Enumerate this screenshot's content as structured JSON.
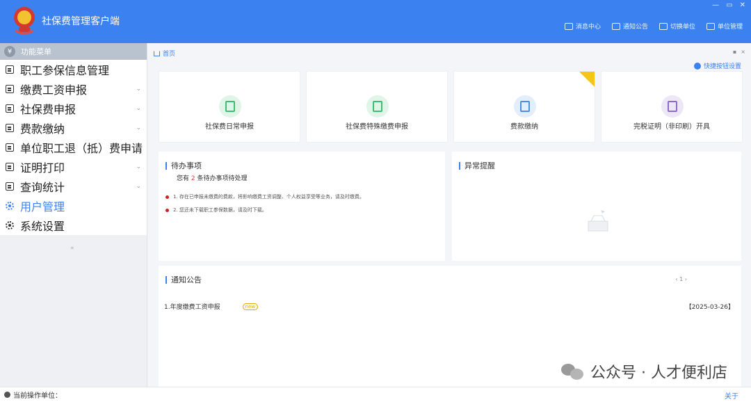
{
  "header": {
    "title": "社保费管理客户端",
    "window_controls": [
      "—",
      "▭",
      "✕"
    ],
    "nav": [
      {
        "label": "消息中心",
        "icon": "bell-icon"
      },
      {
        "label": "通知公告",
        "icon": "notice-icon"
      },
      {
        "label": "切换单位",
        "icon": "switch-icon"
      },
      {
        "label": "单位管理",
        "icon": "building-icon"
      }
    ]
  },
  "sidebar": {
    "header": "功能菜单",
    "header_glyph": "¥",
    "items": [
      {
        "label": "职工参保信息管理",
        "expandable": false,
        "active": false
      },
      {
        "label": "缴费工资申报",
        "expandable": true,
        "active": false
      },
      {
        "label": "社保费申报",
        "expandable": true,
        "active": false
      },
      {
        "label": "费款缴纳",
        "expandable": true,
        "active": false
      },
      {
        "label": "单位职工退（抵）费申请",
        "expandable": false,
        "active": false
      },
      {
        "label": "证明打印",
        "expandable": true,
        "active": false
      },
      {
        "label": "查询统计",
        "expandable": true,
        "active": false
      },
      {
        "label": "用户管理",
        "expandable": false,
        "active": true
      },
      {
        "label": "系统设置",
        "expandable": false,
        "active": false
      }
    ],
    "collapse_glyph": "«"
  },
  "breadcrumb": {
    "home": "首页"
  },
  "quick_settings": "快捷按钮设置",
  "cards": [
    {
      "label": "社保费日常申报",
      "icon_bg": "#dff5e7",
      "icon_color": "#3cbf74"
    },
    {
      "label": "社保费特殊缴费申报",
      "icon_bg": "#dff5e7",
      "icon_color": "#3cbf74"
    },
    {
      "label": "费款缴纳",
      "icon_bg": "#e2eefc",
      "icon_color": "#4a8ee8"
    },
    {
      "label": "完税证明（非印刷）开具",
      "icon_bg": "#ece6f7",
      "icon_color": "#8b6cc9"
    }
  ],
  "todo": {
    "title": "待办事项",
    "summary_prefix": "您有",
    "count": "2",
    "summary_suffix": "条待办事项待处理",
    "items": [
      "1. 存在已申报未缴费的费款，将影响缴费工资调整、个人权益享受等业务，请及时缴费。",
      "2. 您还未下载职工参保数据，请及时下载。"
    ]
  },
  "alerts": {
    "title": "异常提醒"
  },
  "notices": {
    "title": "通知公告",
    "pager": "‹ 1 ›",
    "items": [
      {
        "title": "1.年度缴费工资申报",
        "badge": "new",
        "date": "【2025-03-26】"
      }
    ]
  },
  "status": {
    "current_unit": "当前操作单位：",
    "right_link": "关于"
  },
  "watermark": "公众号 · 人才便利店"
}
